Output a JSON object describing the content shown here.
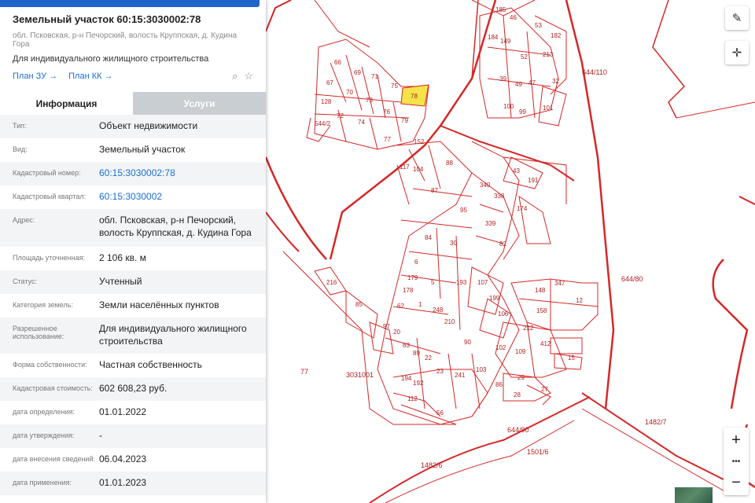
{
  "panel": {
    "title": "Земельный участок 60:15:3030002:78",
    "address_short": "обл. Псковская, р-н Печорский, волость Круппская, д. Кудина Гора",
    "purpose": "Для индивидуального жилищного строительства",
    "links": [
      "План ЗУ →",
      "План КК →"
    ],
    "icons": [
      "search-doc-icon",
      "star-icon"
    ],
    "tabs": [
      "Информация",
      "Услуги"
    ],
    "rows": [
      {
        "label": "Тип:",
        "value": "Объект недвижимости"
      },
      {
        "label": "Вид:",
        "value": "Земельный участок"
      },
      {
        "label": "Кадастровый номер:",
        "value": "60:15:3030002:78"
      },
      {
        "label": "Кадастровый квартал:",
        "value": "60:15:3030002"
      },
      {
        "label": "Адрес:",
        "value": "обл. Псковская, р-н Печорский, волость Круппская, д. Кудина Гора"
      },
      {
        "label": "Площадь уточненная:",
        "value": "2 106 кв. м"
      },
      {
        "label": "Статус:",
        "value": "Учтенный"
      },
      {
        "label": "Категория земель:",
        "value": "Земли населённых пунктов"
      },
      {
        "label": "Разрешенное использование:",
        "value": "Для индивидуального жилищного строительства"
      },
      {
        "label": "Форма собственности:",
        "value": "Частная собственность"
      },
      {
        "label": "Кадастровая стоимость:",
        "value": "602 608,23 руб."
      },
      {
        "label": "дата определения:",
        "value": "01.01.2022"
      },
      {
        "label": "дата утверждения:",
        "value": "-"
      },
      {
        "label": "дата внесения сведений:",
        "value": "06.04.2023"
      },
      {
        "label": "дата применения:",
        "value": "01.01.2023"
      }
    ]
  },
  "map": {
    "selected_parcel": "78",
    "quarter_labels": [
      "3031001",
      "77",
      "644/110",
      "644/80",
      "644/90",
      "1501/6",
      "1482/6",
      "1482/7"
    ],
    "parcel_labels": [
      "66",
      "69",
      "71",
      "75",
      "67",
      "70",
      "73",
      "128",
      "72",
      "74",
      "76",
      "79",
      "77",
      "544/2",
      "78",
      "152",
      "73",
      "88",
      "117",
      "104",
      "87",
      "69",
      "74",
      "95",
      "84",
      "30",
      "6",
      "179",
      "5",
      "193",
      "179",
      "178",
      "1",
      "248",
      "105",
      "62",
      "67",
      "216",
      "85",
      "97",
      "20",
      "83",
      "89",
      "22",
      "23",
      "241",
      "105",
      "103",
      "192",
      "194",
      "112",
      "56",
      "90",
      "86",
      "29",
      "28",
      "27",
      "340",
      "338",
      "174",
      "339",
      "66",
      "82",
      "43",
      "191",
      "107",
      "199",
      "106",
      "148",
      "347",
      "12",
      "158",
      "212",
      "105",
      "412",
      "109",
      "102",
      "15",
      "185",
      "46",
      "184",
      "149",
      "53",
      "182",
      "52",
      "213",
      "39",
      "49",
      "47",
      "32",
      "100",
      "99",
      "101",
      "210"
    ],
    "controls": [
      "ruler-icon",
      "locate-icon"
    ],
    "zoom": [
      "+",
      "•••",
      "−"
    ],
    "colors": {
      "boundary": "#d42828",
      "selected_fill": "#f5e34a",
      "panel_accent": "#1f64c8"
    }
  }
}
